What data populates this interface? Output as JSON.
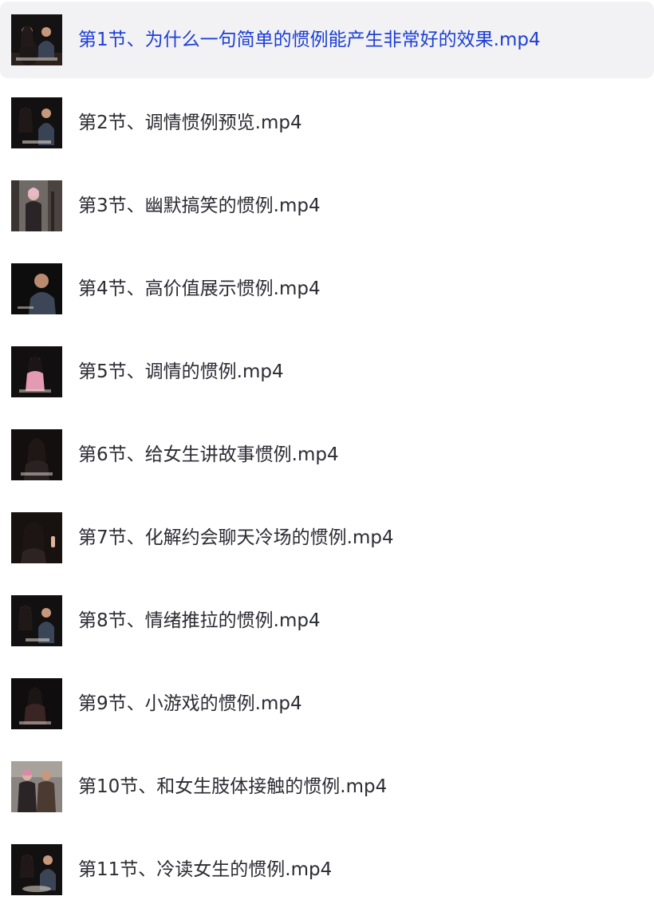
{
  "playlist": {
    "items": [
      {
        "title": "第1节、为什么一句简单的惯例能产生非常好的效果.mp4",
        "active": true,
        "thumb": "two-people-talking-thumbnail"
      },
      {
        "title": "第2节、调情惯例预览.mp4",
        "active": false,
        "thumb": "two-people-talking-thumbnail"
      },
      {
        "title": "第3节、幽默搞笑的惯例.mp4",
        "active": false,
        "thumb": "street-scene-thumbnail"
      },
      {
        "title": "第4节、高价值展示惯例.mp4",
        "active": false,
        "thumb": "man-speaking-thumbnail"
      },
      {
        "title": "第5节、调情的惯例.mp4",
        "active": false,
        "thumb": "woman-pink-thumbnail"
      },
      {
        "title": "第6节、给女生讲故事惯例.mp4",
        "active": false,
        "thumb": "woman-speaking-thumbnail"
      },
      {
        "title": "第7节、化解约会聊天冷场的惯例.mp4",
        "active": false,
        "thumb": "woman-gesture-thumbnail"
      },
      {
        "title": "第8节、情绪推拉的惯例.mp4",
        "active": false,
        "thumb": "two-people-talking-thumbnail"
      },
      {
        "title": "第9节、小游戏的惯例.mp4",
        "active": false,
        "thumb": "woman-speaking-thumbnail"
      },
      {
        "title": "第10节、和女生肢体接触的惯例.mp4",
        "active": false,
        "thumb": "street-couple-thumbnail"
      },
      {
        "title": "第11节、冷读女生的惯例.mp4",
        "active": false,
        "thumb": "two-people-talking-thumbnail"
      }
    ]
  },
  "colors": {
    "active_text": "#1d3fd6",
    "text": "#2b2b33",
    "active_bg": "#f2f2f4"
  }
}
